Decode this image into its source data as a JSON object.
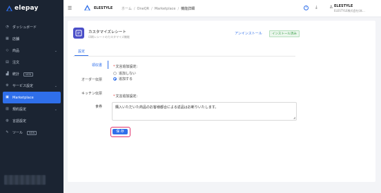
{
  "app": {
    "brand": "elepay",
    "accent": "#2f6fea"
  },
  "sidebar": {
    "items": [
      {
        "label": "ダッシュボード",
        "icon": "dashboard-icon",
        "chevron": false,
        "badge": ""
      },
      {
        "label": "店舗",
        "icon": "store-icon",
        "chevron": false,
        "badge": ""
      },
      {
        "label": "商品",
        "icon": "tag-icon",
        "chevron": true,
        "badge": ""
      },
      {
        "label": "注文",
        "icon": "receipt-icon",
        "chevron": false,
        "badge": ""
      },
      {
        "label": "統計",
        "icon": "chart-icon",
        "chevron": false,
        "badge": "NEW"
      },
      {
        "label": "サービス設定",
        "icon": "settings-icon",
        "chevron": true,
        "badge": ""
      },
      {
        "label": "Marketplace",
        "icon": "marketplace-icon",
        "chevron": false,
        "badge": "",
        "active": true
      },
      {
        "label": "規約設定",
        "icon": "document-icon",
        "chevron": true,
        "badge": ""
      },
      {
        "label": "言語設定",
        "icon": "globe-icon",
        "chevron": false,
        "badge": ""
      },
      {
        "label": "ツール",
        "icon": "tool-icon",
        "chevron": false,
        "badge": "NEW"
      }
    ]
  },
  "topbar": {
    "store_name": "ELESTYLE",
    "breadcrumb": [
      "ホーム",
      "OneQR",
      "Marketplace",
      "機能詳細"
    ],
    "help": "?",
    "user_name": "ELESTYLE",
    "user_company": "ELESTYLE株式会社(本..."
  },
  "app_detail": {
    "title": "カスタマイズレシート",
    "description": "印刷レシートのカスタマイズ機能",
    "uninstall_label": "アンインストール",
    "installed_badge": "インストール済み",
    "tab": "設定"
  },
  "settings": {
    "vtabs": [
      "領収書",
      "オーダー伝票",
      "キッチン伝票",
      "食券"
    ],
    "label_additional": "文言追加設定:",
    "radio_no": "追加しない",
    "radio_yes": "追加する",
    "radio_selected": "追加する",
    "label_text": "文言追加設定:",
    "textarea_value": "購入いただいた商品のお客様都合による返品はお断りいたします。",
    "save_label": "保 存"
  }
}
